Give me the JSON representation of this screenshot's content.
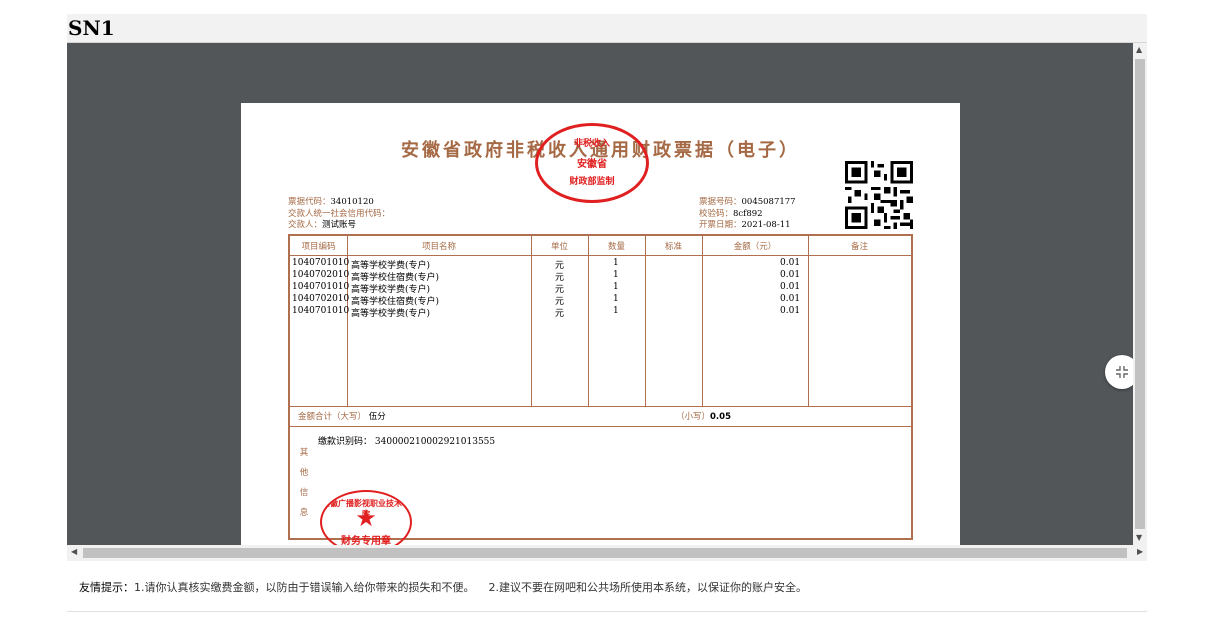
{
  "window": {
    "title": "SN1"
  },
  "invoice": {
    "title": "安徽省政府非税收入通用财政票据（电子）",
    "stamp_top": {
      "line1": "财政部监制",
      "line2": "安徽省",
      "line3": "非税收入"
    },
    "left_meta": {
      "code_label": "票据代码：",
      "code_value": "34010120",
      "credit_label": "交款人统一社会信用代码：",
      "credit_value": "",
      "payer_label": "交款人：",
      "payer_value": "测试账号"
    },
    "right_meta": {
      "number_label": "票据号码：",
      "number_value": "0045087177",
      "check_label": "校验码：",
      "check_value": "8cf892",
      "date_label": "开票日期：",
      "date_value": "2021-08-11"
    },
    "headers": [
      "项目编码",
      "项目名称",
      "单位",
      "数量",
      "标准",
      "金额（元）",
      "备注"
    ],
    "rows": [
      {
        "code": "1040701010",
        "name": "高等学校学费(专户)",
        "unit": "元",
        "qty": "1",
        "std": "",
        "amount": "0.01",
        "note": ""
      },
      {
        "code": "1040702010",
        "name": "高等学校住宿费(专户)",
        "unit": "元",
        "qty": "1",
        "std": "",
        "amount": "0.01",
        "note": ""
      },
      {
        "code": "1040701010",
        "name": "高等学校学费(专户)",
        "unit": "元",
        "qty": "1",
        "std": "",
        "amount": "0.01",
        "note": ""
      },
      {
        "code": "1040702010",
        "name": "高等学校住宿费(专户)",
        "unit": "元",
        "qty": "1",
        "std": "",
        "amount": "0.01",
        "note": ""
      },
      {
        "code": "1040701010",
        "name": "高等学校学费(专户)",
        "unit": "元",
        "qty": "1",
        "std": "",
        "amount": "0.01",
        "note": ""
      }
    ],
    "total_label": "金额合计（大写）",
    "total_upper": "伍分",
    "total_small_label": "（小写）",
    "total_small": "0.05",
    "other_label": [
      "其",
      "他",
      "信",
      "息"
    ],
    "ident_label": "缴款识别码：",
    "ident_value": "340000210002921013555",
    "stamp_bottom": {
      "line1": "安徽广播影视职业技术学院",
      "line2": "财务专用章"
    }
  },
  "tip": {
    "label": "友情提示：",
    "text1": "1.请你认真核实缴费金额，以防由于错误输入给你带来的损失和不便。",
    "text2": "2.建议不要在网吧和公共场所使用本系统，以保证你的账户安全。"
  },
  "icons": {
    "fold": "fold-toggle-icon",
    "qr": "qr-code-icon",
    "star": "star-icon"
  },
  "colors": {
    "accent": "#a56a45",
    "stamp": "#e02020",
    "viewer_bg": "#525659"
  }
}
